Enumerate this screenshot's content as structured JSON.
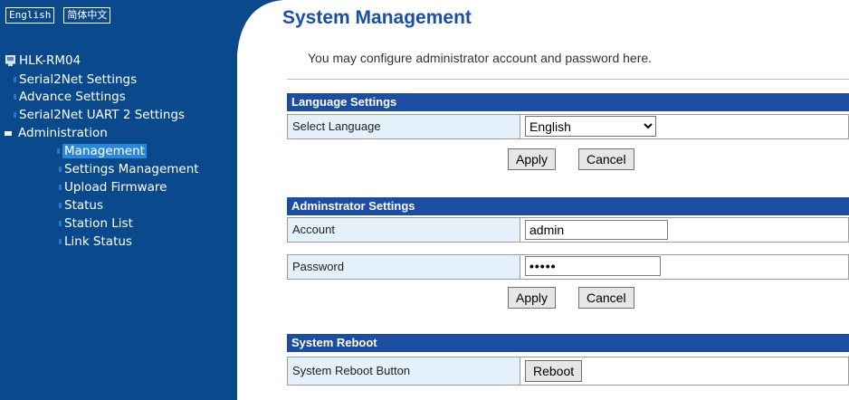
{
  "sidebar": {
    "lang_buttons": [
      "English",
      "简体中文"
    ],
    "device": "HLK-RM04",
    "items": [
      {
        "label": "Serial2Net Settings"
      },
      {
        "label": "Advance Settings"
      },
      {
        "label": "Serial2Net UART 2 Settings"
      },
      {
        "label": "Administration"
      },
      {
        "label": "Management"
      },
      {
        "label": "Settings Management"
      },
      {
        "label": "Upload Firmware"
      },
      {
        "label": "Status"
      },
      {
        "label": "Station List"
      },
      {
        "label": "Link Status"
      }
    ]
  },
  "page": {
    "title": "System Management",
    "intro": "You may configure administrator account and password here."
  },
  "language": {
    "heading": "Language Settings",
    "select_label": "Select Language",
    "selected": "English",
    "apply": "Apply",
    "cancel": "Cancel"
  },
  "admin": {
    "heading": "Adminstrator Settings",
    "account_label": "Account",
    "account_value": "admin",
    "password_label": "Password",
    "password_value": "•••••",
    "apply": "Apply",
    "cancel": "Cancel"
  },
  "reboot": {
    "heading": "System Reboot",
    "label": "System Reboot Button",
    "button": "Reboot"
  },
  "colors": {
    "sidebar_bg": "#0a4a8c",
    "section_header": "#1c4da0",
    "title": "#1a4fa3",
    "label_cell": "#e4f1fb"
  }
}
